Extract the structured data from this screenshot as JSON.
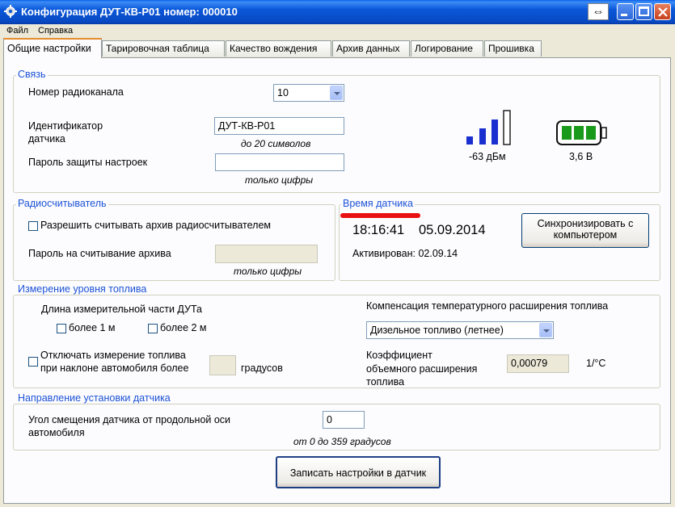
{
  "window": {
    "title": "Конфигурация ДУТ-КВ-Р01 номер: 000010",
    "icon": "gear-icon",
    "controls": {
      "swap": "⇔"
    }
  },
  "menu": {
    "items": [
      "Файл",
      "Справка"
    ]
  },
  "tabs": [
    "Общие настройки",
    "Тарировочная таблица",
    "Качество вождения",
    "Архив данных",
    "Логирование",
    "Прошивка"
  ],
  "active_tab": "Общие настройки",
  "connection": {
    "title": "Связь",
    "channel_label": "Номер радиоканала",
    "channel_value": "10",
    "id_label_1": "Идентификатор",
    "id_label_2": "датчика",
    "id_value": "ДУТ-КВ-Р01",
    "id_hint": "до 20 символов",
    "password_label": "Пароль защиты настроек",
    "password_value": "",
    "password_hint": "только цифры",
    "signal_text": "-63 дБм",
    "signal_level_bars": 3,
    "signal_total_bars": 4,
    "battery_text": "3,6 В",
    "battery_level_cells": 3,
    "signal_color": "#1a2fd0",
    "battery_color": "#1a9a1a"
  },
  "radio_reader": {
    "title": "Радиосчитыватель",
    "allow_label": "Разрешить считывать архив радиосчитывателем",
    "allow_checked": false,
    "password_label": "Пароль на считывание архива",
    "password_value": "",
    "password_hint": "только цифры"
  },
  "sensor_time": {
    "title": "Время датчика",
    "time": "18:16:41",
    "date": "05.09.2014",
    "activated_label": "Активирован: 02.09.14",
    "sync_button_1": "Синхронизировать с",
    "sync_button_2": "компьютером",
    "highlight_color": "#e81010"
  },
  "fuel": {
    "title": "Измерение уровня топлива",
    "length_label": "Длина измерительной части ДУТа",
    "more_1m": "более 1 м",
    "more_2m": "более 2 м",
    "disable_label_1": "Отключать измерение топлива",
    "disable_label_2": "при наклоне автомобиля более",
    "degrees_label": "градусов",
    "degrees_value": "",
    "compensation_label": "Компенсация температурного расширения топлива",
    "fuel_type": "Дизельное топливо (летнее)",
    "coef_label_1": "Коэффициент",
    "coef_label_2": "объемного расширения",
    "coef_label_3": "топлива",
    "coef_value": "0,00079",
    "coef_unit": "1/°C"
  },
  "direction": {
    "title": "Направление установки датчика",
    "angle_label_1": "Угол смещения датчика от продольной оси",
    "angle_label_2": "автомобиля",
    "angle_value": "0",
    "angle_hint": "от 0 до 359 градусов"
  },
  "write_button": "Записать настройки в датчик"
}
